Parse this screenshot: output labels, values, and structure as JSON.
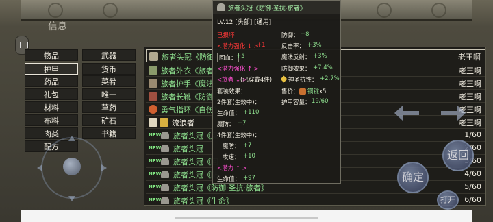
{
  "top": {
    "info_label": "信息"
  },
  "categories": [
    {
      "label": "物品"
    },
    {
      "label": "武器"
    },
    {
      "label": "护甲"
    },
    {
      "label": "货币"
    },
    {
      "label": "药品"
    },
    {
      "label": "菜肴"
    },
    {
      "label": "礼包"
    },
    {
      "label": "唯一"
    },
    {
      "label": "材料"
    },
    {
      "label": "草药"
    },
    {
      "label": "布料"
    },
    {
      "label": "矿石"
    },
    {
      "label": "肉类"
    },
    {
      "label": "书籍"
    },
    {
      "label": "配方"
    }
  ],
  "selected_category": "护甲",
  "items": [
    {
      "name": "旅者头冠《防御·",
      "right": "老王啊",
      "new": false,
      "color": "green"
    },
    {
      "name": "旅者外衣《旅者》",
      "right": "老王啊",
      "new": false,
      "color": "green"
    },
    {
      "name": "旅者护手《魔法·",
      "right": "老王啊",
      "new": false,
      "color": "green"
    },
    {
      "name": "旅者长靴《防御·",
      "right": "老王啊",
      "new": false,
      "color": "green"
    },
    {
      "name": "勇气指环《自伤》",
      "right": "老王啊",
      "new": false,
      "color": "green"
    },
    {
      "name": "流浪者",
      "right": "老王啊",
      "new": false,
      "color": "white"
    },
    {
      "name": "旅者头冠《魔",
      "right": "1/60",
      "new": true,
      "color": "green"
    },
    {
      "name": "旅者头冠",
      "right": "2/60",
      "new": true,
      "color": "green"
    },
    {
      "name": "旅者头冠《回",
      "right": "3/60",
      "new": true,
      "color": "green"
    },
    {
      "name": "旅者头冠《防",
      "right": "4/60",
      "new": true,
      "color": "green"
    },
    {
      "name": "旅者头冠《防御·圣抗·旅者》",
      "right": "5/60",
      "new": true,
      "color": "green"
    },
    {
      "name": "旅者头冠《生命》",
      "right": "6/60",
      "new": true,
      "color": "green"
    }
  ],
  "new_badge": "NEW",
  "tooltip": {
    "title": "旅者头冠《防御·圣抗·旅者》",
    "level_line": "LV.12 [头部] [通用]",
    "status_red": "已损坏",
    "defense_label": "防御：",
    "defense_value": "+8",
    "inherit1_label": "<潜力强化 ↓ >",
    "inherit1_value": "+1",
    "counter_label": "反击率：",
    "counter_value": "+3%",
    "heal_label": "回血：",
    "heal_value": "+5",
    "reflect_label": "魔法反射：",
    "reflect_value": "+3%",
    "inherit2_label": "<潜力强化 ↑ >",
    "defense_eff_label": "防御效果：",
    "defense_eff_value": "+7.4%",
    "set_label": "<旅者 ↓ >",
    "set_worn": "(已穿戴4件)",
    "holy_label": "神圣抗性：",
    "holy_value": "+2.7%",
    "set_effect": "套装效果：",
    "price_label": "售价：",
    "price_item": "铜锭",
    "price_count": "x5",
    "set2_label": "2件套(生效中)：",
    "armor_cap_label": "护甲容量：",
    "armor_cap_value": "19/60",
    "hp_label": "生命值：",
    "hp_value": "+110",
    "mdef_label": "魔防：",
    "mdef_value": "+7",
    "set4_label": "4件套(生效中)：",
    "mdef2_label": "魔防：",
    "mdef2_value": "+7",
    "atk_label": "攻速：",
    "atk_value": "+10",
    "inherit3_label": "<潜力 ↑ >",
    "hp2_label": "生命值：",
    "hp2_value": "+97"
  },
  "buttons": {
    "back": "返回",
    "confirm": "确定",
    "open": "打开"
  }
}
